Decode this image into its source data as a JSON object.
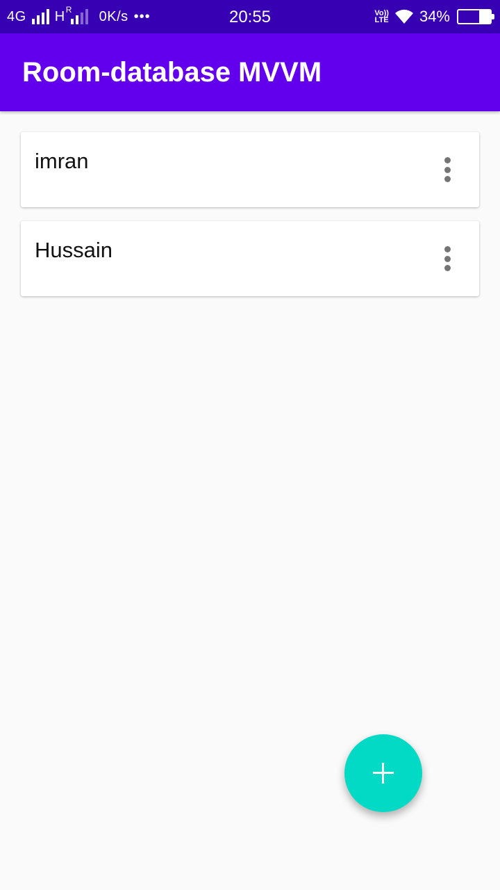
{
  "status_bar": {
    "network_type": "4G",
    "second_network": "H",
    "roaming": "R",
    "data_speed": "0K/s",
    "more_dots": "•••",
    "time": "20:55",
    "volte_top": "Vo))",
    "volte_bottom": "LTE",
    "battery_percent": "34%",
    "battery_level": 0.34
  },
  "app_bar": {
    "title": "Room-database MVVM",
    "color": "#6200ee"
  },
  "list": {
    "items": [
      {
        "name": "imran",
        "menu_icon": "more-vert-icon"
      },
      {
        "name": "Hussain",
        "menu_icon": "more-vert-icon"
      }
    ]
  },
  "fab": {
    "icon": "plus-icon",
    "color": "#03dac5"
  }
}
